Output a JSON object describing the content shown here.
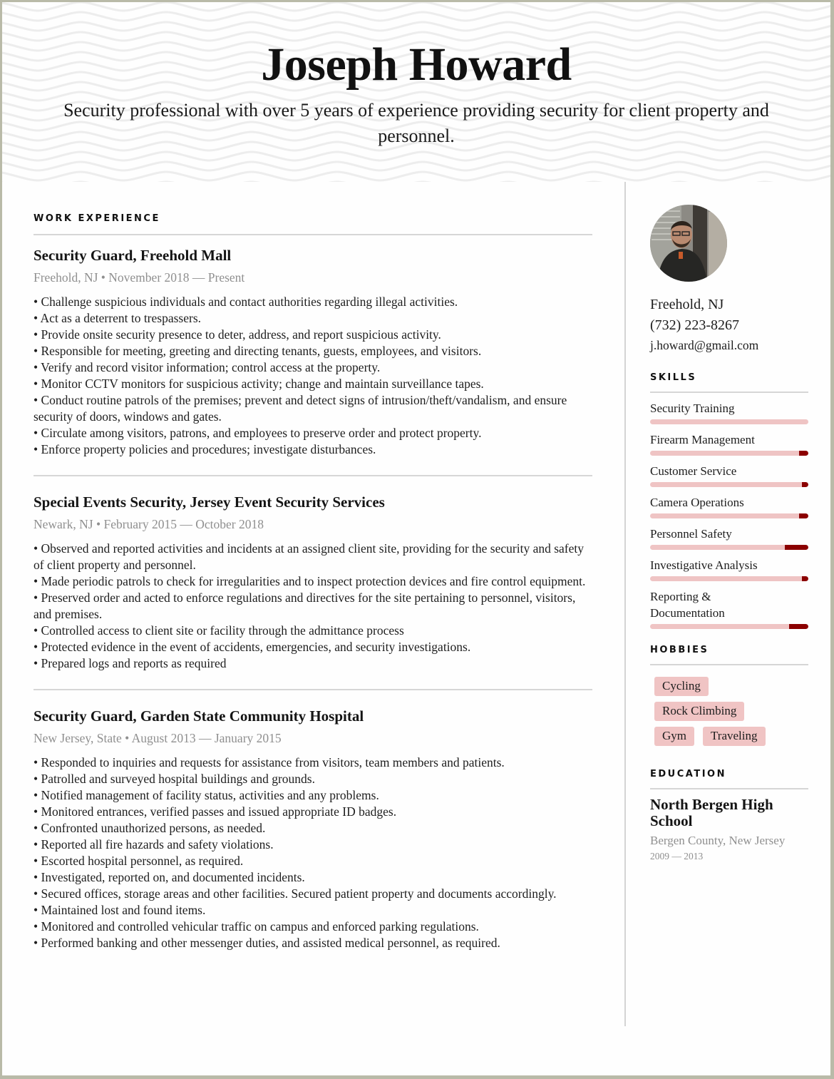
{
  "header": {
    "name": "Joseph Howard",
    "summary": "Security professional with over 5 years of experience providing security for client property and personnel."
  },
  "work_experience": {
    "title": "WORK EXPERIENCE",
    "jobs": [
      {
        "title": "Security Guard, Freehold Mall",
        "meta": "Freehold, NJ • November 2018 — Present",
        "bullets": [
          "• Challenge suspicious individuals and contact authorities regarding illegal activities.",
          "• Act as a deterrent to trespassers.",
          "• Provide onsite security presence to deter, address, and report suspicious activity.",
          "• Responsible for meeting, greeting and directing tenants, guests, employees, and visitors.",
          "• Verify and record visitor information; control access at the property.",
          "• Monitor CCTV monitors for suspicious activity; change and maintain surveillance tapes.",
          "• Conduct routine patrols of the premises; prevent and detect signs of intrusion/theft/vandalism, and ensure security of doors, windows and gates.",
          "• Circulate among visitors, patrons, and employees to preserve order and protect property.",
          "• Enforce property policies and procedures; investigate disturbances."
        ]
      },
      {
        "title": "Special Events Security, Jersey Event Security Services",
        "meta": "Newark, NJ • February 2015 — October 2018",
        "bullets": [
          "• Observed and reported activities and incidents at an assigned client site, providing for the security and safety of client property and personnel.",
          "• Made periodic patrols to check for irregularities and to inspect protection devices and fire control equipment.",
          "• Preserved order and acted to enforce regulations and directives for the site pertaining to personnel, visitors, and premises.",
          "• Controlled access to client site or facility through the admittance process",
          "• Protected evidence in the event of accidents, emergencies, and security investigations.",
          "• Prepared logs and reports as required"
        ]
      },
      {
        "title": "Security Guard, Garden State Community Hospital",
        "meta": "New Jersey, State • August 2013 — January 2015",
        "bullets": [
          "• Responded to inquiries and requests for assistance from visitors, team members and patients.",
          "• Patrolled and surveyed hospital buildings and grounds.",
          "• Notified management of facility status, activities and any problems.",
          "• Monitored entrances, verified passes and issued appropriate ID badges.",
          "• Confronted unauthorized persons, as needed.",
          "• Reported all fire hazards and safety violations.",
          "• Escorted hospital personnel, as required.",
          "• Investigated, reported on, and documented incidents.",
          "• Secured offices, storage areas and other facilities. Secured patient property and documents accordingly.",
          "• Maintained lost and found items.",
          "• Monitored and controlled vehicular traffic on campus and enforced parking regulations.",
          "• Performed banking and other messenger duties, and assisted medical personnel, as required."
        ]
      }
    ]
  },
  "sidebar": {
    "avatar_icon": "person-photo",
    "location": "Freehold, NJ",
    "phone": "(732) 223-8267",
    "email": "j.howard@gmail.com",
    "skills_title": "SKILLS",
    "skills": [
      {
        "label": "Security Training",
        "marker_fraction": 0.0
      },
      {
        "label": "Firearm Management",
        "marker_fraction": 0.06
      },
      {
        "label": "Customer Service",
        "marker_fraction": 0.04
      },
      {
        "label": "Camera Operations",
        "marker_fraction": 0.06
      },
      {
        "label": "Personnel Safety",
        "marker_fraction": 0.15
      },
      {
        "label": "Investigative Analysis",
        "marker_fraction": 0.04
      },
      {
        "label": "Reporting & Documentation",
        "marker_fraction": 0.12
      }
    ],
    "hobbies_title": "HOBBIES",
    "hobbies": [
      [
        "Cycling"
      ],
      [
        "Rock Climbing"
      ],
      [
        "Gym",
        "Traveling"
      ]
    ],
    "education_title": "EDUCATION",
    "education": {
      "school": "North Bergen High School",
      "place": "Bergen County, New Jersey",
      "years": "2009 — 2013"
    }
  },
  "colors": {
    "skill_track": "#efc4c4",
    "skill_marker": "#8b0000",
    "hobby_chip": "#f0c4c4",
    "meta_text": "#8f8f8f"
  }
}
